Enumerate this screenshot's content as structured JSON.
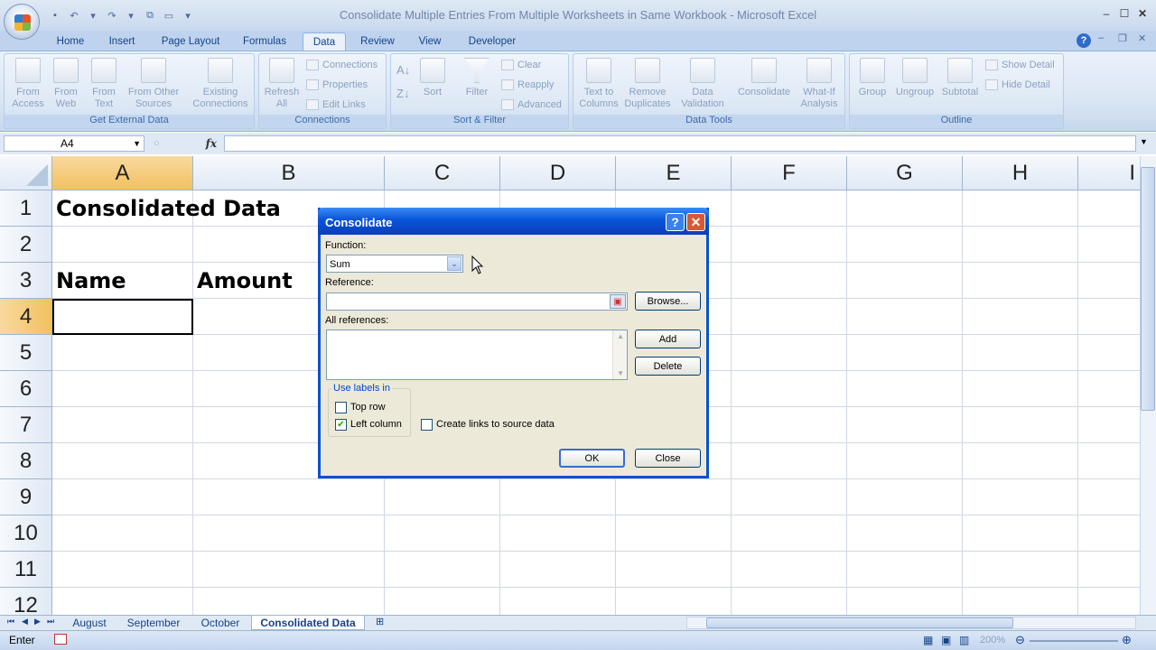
{
  "window": {
    "title": "Consolidate Multiple Entries From Multiple Worksheets in Same Workbook - Microsoft Excel"
  },
  "ribbon_tabs": [
    "Home",
    "Insert",
    "Page Layout",
    "Formulas",
    "Data",
    "Review",
    "View",
    "Developer"
  ],
  "active_tab": "Data",
  "groups": {
    "external": {
      "label": "Get External Data",
      "buttons": [
        "From Access",
        "From Web",
        "From Text",
        "From Other Sources",
        "Existing Connections"
      ]
    },
    "connections": {
      "label": "Connections",
      "refresh": "Refresh All",
      "items": [
        "Connections",
        "Properties",
        "Edit Links"
      ]
    },
    "sortfilter": {
      "label": "Sort & Filter",
      "sort": "Sort",
      "filter": "Filter",
      "items": [
        "Clear",
        "Reapply",
        "Advanced"
      ]
    },
    "datatools": {
      "label": "Data Tools",
      "buttons": [
        "Text to Columns",
        "Remove Duplicates",
        "Data Validation",
        "Consolidate",
        "What-If Analysis"
      ]
    },
    "outline": {
      "label": "Outline",
      "buttons": [
        "Group",
        "Ungroup",
        "Subtotal"
      ],
      "items": [
        "Show Detail",
        "Hide Detail"
      ]
    }
  },
  "formula_bar": {
    "name_box": "A4",
    "fx": "fx",
    "value": ""
  },
  "columns": [
    "A",
    "B",
    "C",
    "D",
    "E",
    "F",
    "G",
    "H",
    "I"
  ],
  "rows": [
    "1",
    "2",
    "3",
    "4",
    "5",
    "6",
    "7",
    "8",
    "9",
    "10",
    "11",
    "12"
  ],
  "cells": {
    "A1": "Consolidated Data",
    "A3": "Name",
    "B3": "Amount"
  },
  "sheet_tabs": [
    "August",
    "September",
    "October",
    "Consolidated Data"
  ],
  "active_sheet": "Consolidated Data",
  "status": {
    "mode": "Enter",
    "zoom": "200%"
  },
  "dialog": {
    "title": "Consolidate",
    "function_label": "Function:",
    "function_value": "Sum",
    "reference_label": "Reference:",
    "reference_value": "",
    "browse": "Browse...",
    "all_refs_label": "All references:",
    "add": "Add",
    "delete": "Delete",
    "use_labels": "Use labels in",
    "top_row": "Top row",
    "top_row_checked": false,
    "left_column": "Left column",
    "left_column_checked": true,
    "create_links": "Create links to source data",
    "create_links_checked": false,
    "ok": "OK",
    "close": "Close"
  }
}
